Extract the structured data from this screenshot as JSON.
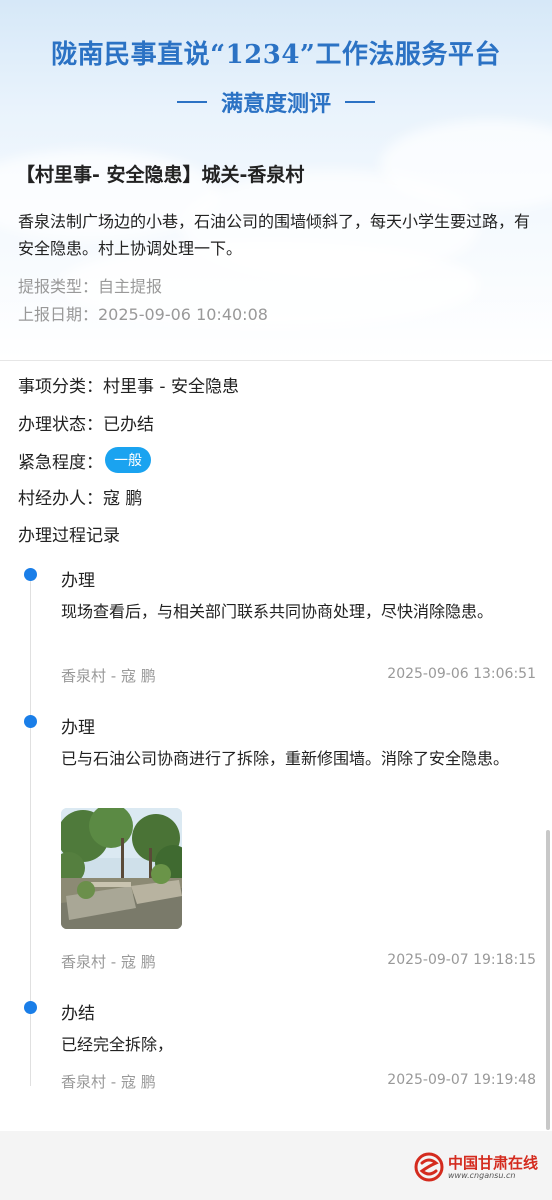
{
  "header": {
    "title": "陇南民事直说“1234”工作法服务平台",
    "subtitle": "满意度测评"
  },
  "case": {
    "title": "【村里事- 安全隐患】城关-香泉村",
    "description": "香泉法制广场边的小巷，石油公司的围墙倾斜了，每天小学生要过路，有安全隐患。村上协调处理一下。",
    "report_type": "提报类型：自主提报",
    "report_date": "上报日期：2025-09-06 10:40:08"
  },
  "details": {
    "category": "事项分类：村里事 - 安全隐患",
    "status": "办理状态：已办结",
    "urgency_label": "紧急程度：",
    "urgency_value": "一般",
    "handler": "村经办人：寇 鹏",
    "records_title": "办理过程记录"
  },
  "records": [
    {
      "title": "办理",
      "content": "现场查看后，与相关部门联系共同协商处理，尽快消除隐患。",
      "author": "香泉村 - 寇 鹏",
      "time": "2025-09-06 13:06:51"
    },
    {
      "title": "办理",
      "content": "已与石油公司协商进行了拆除，重新修围墙。消除了安全隐患。",
      "author": "香泉村 - 寇 鹏",
      "time": "2025-09-07 19:18:15"
    },
    {
      "title": "办结",
      "content": "已经完全拆除，",
      "author": "香泉村 - 寇 鹏",
      "time": "2025-09-07 19:19:48"
    }
  ],
  "footer": {
    "logo_text": "中国甘肃在线",
    "logo_url": "www.cngansu.cn"
  },
  "colors": {
    "accent": "#2b72c4",
    "timeline_dot": "#1a7ee8",
    "badge": "#1aa3f0",
    "logo_red": "#d42b1e"
  },
  "icons": {
    "timeline_dot": "dot-icon",
    "logo": "cngansu-logo"
  }
}
